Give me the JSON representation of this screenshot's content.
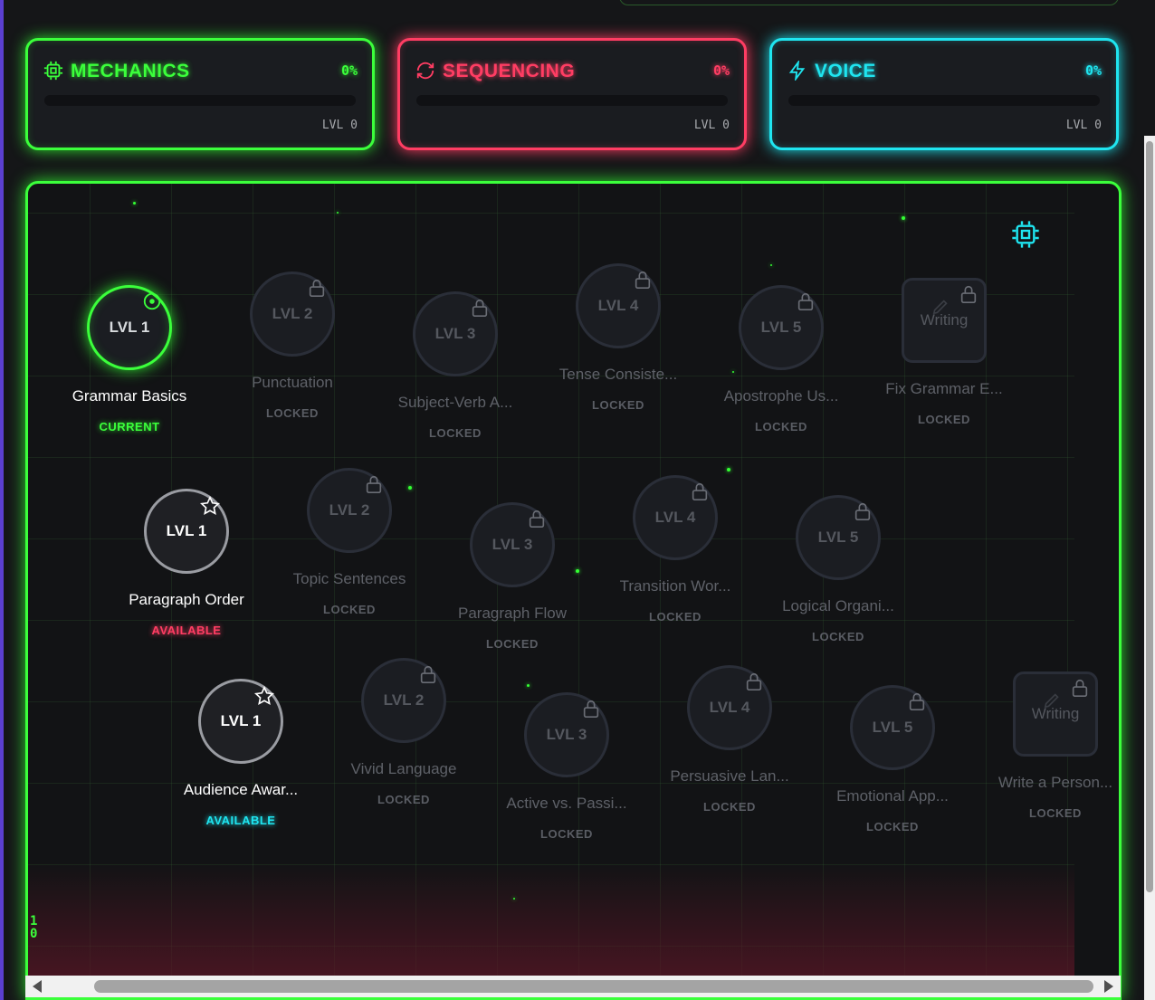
{
  "categories": [
    {
      "id": "mech",
      "title": "MECHANICS",
      "percent": "0%",
      "level": "LVL 0",
      "color": "#3bff3b",
      "progress": 0,
      "icon": "chip-icon"
    },
    {
      "id": "seq",
      "title": "SEQUENCING",
      "percent": "0%",
      "level": "LVL 0",
      "color": "#ff3d63",
      "progress": 0,
      "icon": "refresh-icon"
    },
    {
      "id": "voice",
      "title": "VOICE",
      "percent": "0%",
      "level": "LVL 0",
      "color": "#1fe5f0",
      "progress": 0,
      "icon": "lightning-icon"
    }
  ],
  "map": {
    "side_digits": [
      "1",
      "0"
    ],
    "rows": [
      {
        "color": "#3bff3b",
        "nodes": [
          {
            "label": "LVL 1",
            "name": "Grammar Basics",
            "status": "CURRENT",
            "state": "current"
          },
          {
            "label": "LVL 2",
            "name": "Punctuation",
            "status": "LOCKED",
            "state": "locked"
          },
          {
            "label": "LVL 3",
            "name": "Subject-Verb A...",
            "status": "LOCKED",
            "state": "locked"
          },
          {
            "label": "LVL 4",
            "name": "Tense Consiste...",
            "status": "LOCKED",
            "state": "locked"
          },
          {
            "label": "LVL 5",
            "name": "Apostrophe Us...",
            "status": "LOCKED",
            "state": "locked"
          },
          {
            "label": "Writing",
            "name": "Fix Grammar E...",
            "status": "LOCKED",
            "state": "writing"
          }
        ]
      },
      {
        "color": "#ff3d63",
        "nodes": [
          {
            "label": "LVL 1",
            "name": "Paragraph Order",
            "status": "AVAILABLE",
            "state": "available"
          },
          {
            "label": "LVL 2",
            "name": "Topic Sentences",
            "status": "LOCKED",
            "state": "locked"
          },
          {
            "label": "LVL 3",
            "name": "Paragraph Flow",
            "status": "LOCKED",
            "state": "locked"
          },
          {
            "label": "LVL 4",
            "name": "Transition Wor...",
            "status": "LOCKED",
            "state": "locked"
          },
          {
            "label": "LVL 5",
            "name": "Logical Organi...",
            "status": "LOCKED",
            "state": "locked"
          }
        ]
      },
      {
        "color": "#1fe5f0",
        "nodes": [
          {
            "label": "LVL 1",
            "name": "Audience Awar...",
            "status": "AVAILABLE",
            "state": "available"
          },
          {
            "label": "LVL 2",
            "name": "Vivid Language",
            "status": "LOCKED",
            "state": "locked"
          },
          {
            "label": "LVL 3",
            "name": "Active vs. Passi...",
            "status": "LOCKED",
            "state": "locked"
          },
          {
            "label": "LVL 4",
            "name": "Persuasive Lan...",
            "status": "LOCKED",
            "state": "locked"
          },
          {
            "label": "LVL 5",
            "name": "Emotional App...",
            "status": "LOCKED",
            "state": "locked"
          },
          {
            "label": "Writing",
            "name": "Write a Person...",
            "status": "LOCKED",
            "state": "writing"
          }
        ]
      }
    ]
  }
}
